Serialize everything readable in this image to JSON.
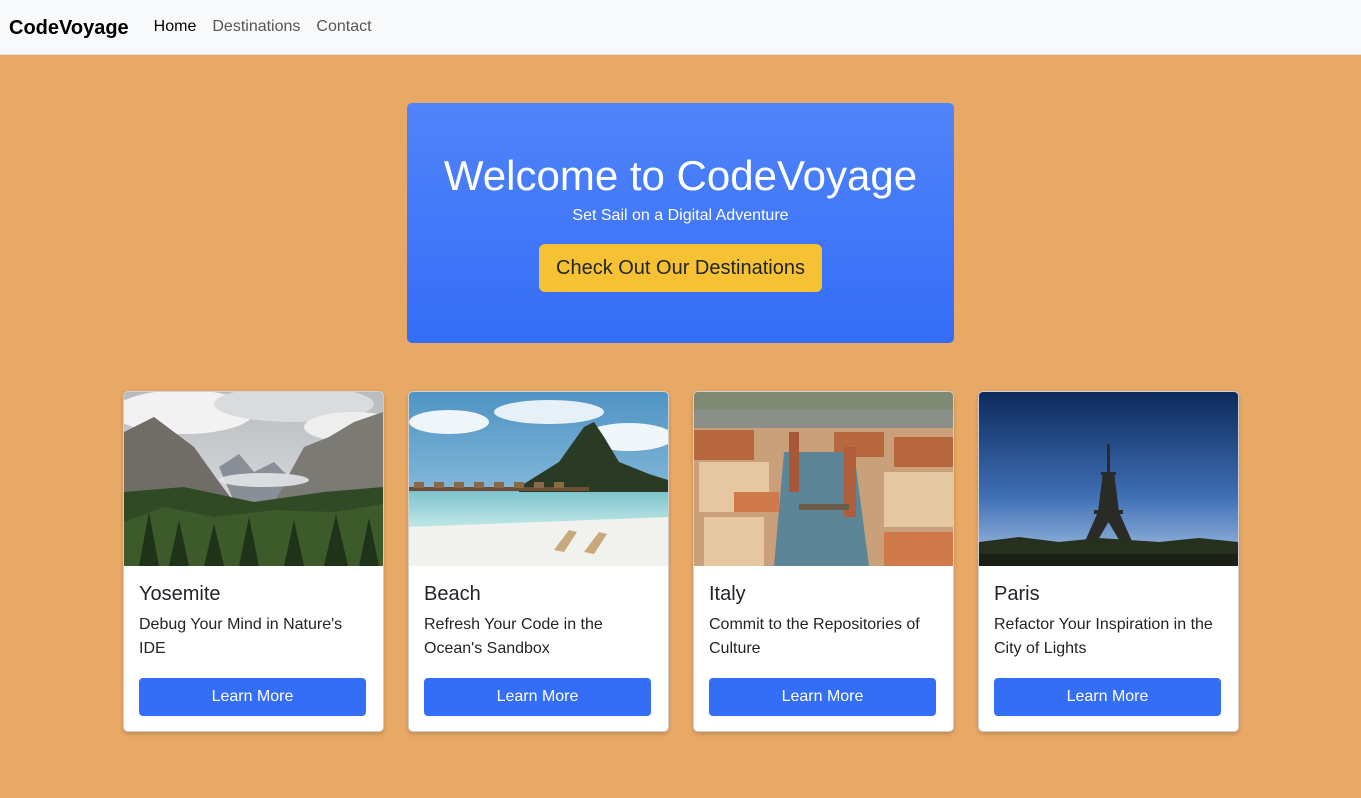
{
  "nav": {
    "brand": "CodeVoyage",
    "links": [
      "Home",
      "Destinations",
      "Contact"
    ]
  },
  "hero": {
    "title": "Welcome to CodeVoyage",
    "subtitle": "Set Sail on a Digital Adventure",
    "button": "Check Out Our Destinations"
  },
  "cards": [
    {
      "title": "Yosemite",
      "text": "Debug Your Mind in Nature's IDE",
      "button": "Learn More"
    },
    {
      "title": "Beach",
      "text": "Refresh Your Code in the Ocean's Sandbox",
      "button": "Learn More"
    },
    {
      "title": "Italy",
      "text": "Commit to the Repositories of Culture",
      "button": "Learn More"
    },
    {
      "title": "Paris",
      "text": "Refactor Your Inspiration in the City of Lights",
      "button": "Learn More"
    }
  ],
  "colors": {
    "page_background": "#e8a866",
    "hero_gradient_top": "#5184fa",
    "hero_gradient_bottom": "#346df6",
    "hero_button": "#f6c132",
    "card_button": "#346df6"
  }
}
